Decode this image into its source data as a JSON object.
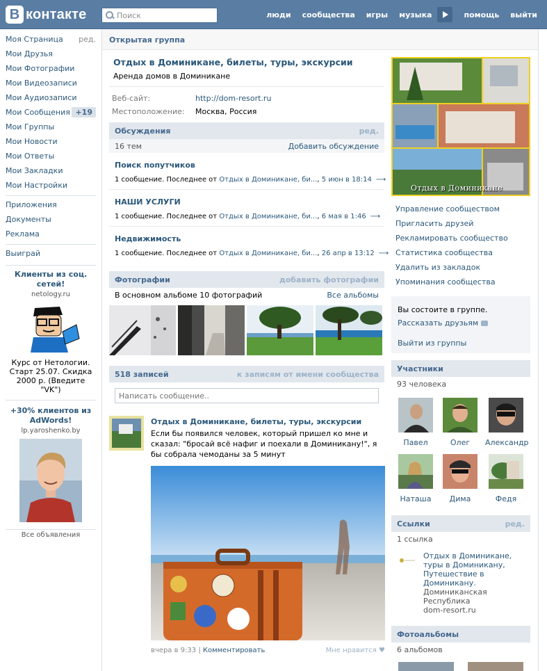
{
  "header": {
    "logo_letter": "В",
    "logo_text": "контакте",
    "search_placeholder": "Поиск",
    "nav": [
      "люди",
      "сообщества",
      "игры",
      "музыка",
      "помощь",
      "выйти"
    ]
  },
  "left_menu": {
    "items": [
      {
        "label": "Моя Страница",
        "extra": "ред."
      },
      {
        "label": "Мои Друзья"
      },
      {
        "label": "Мои Фотографии"
      },
      {
        "label": "Мои Видеозаписи"
      },
      {
        "label": "Мои Аудиозаписи"
      },
      {
        "label": "Мои Сообщения",
        "count": "+19"
      },
      {
        "label": "Мои Группы"
      },
      {
        "label": "Мои Новости"
      },
      {
        "label": "Мои Ответы"
      },
      {
        "label": "Мои Закладки"
      },
      {
        "label": "Мои Настройки"
      }
    ],
    "secondary": [
      "Приложения",
      "Документы",
      "Реклама"
    ],
    "tertiary": [
      "Выиграй"
    ]
  },
  "ads": [
    {
      "title": "Клиенты из соц. сетей!",
      "domain": "netology.ru",
      "text": "Курс от Нетологии. Старт 25.07. Скидка 2000 р. (Введите \"VK\")"
    },
    {
      "title": "+30% клиентов из AdWords!",
      "domain": "lp.yaroshenko.by"
    }
  ],
  "all_ads_label": "Все объявления",
  "breadcrumb": "Открытая группа",
  "group": {
    "name": "Отдых в Доминикане, билеты, туры, экскурсии",
    "status": "Аренда домов в Доминикане",
    "website_label": "Веб-сайт:",
    "website_value": "http://dom-resort.ru",
    "location_label": "Местоположение:",
    "location_value": "Москва, Россия",
    "cover_caption": "Отдых в Доминикане"
  },
  "discussions": {
    "title": "Обсуждения",
    "edit": "ред.",
    "count": "16 тем",
    "add": "Добавить обсуждение",
    "topics": [
      {
        "title": "Поиск попутчиков",
        "meta_prefix": "1 сообщение. Последнее от ",
        "author": "Отдых в Доминикане, би...",
        "date": "5 июн в 18:14"
      },
      {
        "title": "НАШИ УСЛУГИ",
        "meta_prefix": "1 сообщение. Последнее от ",
        "author": "Отдых в Доминикане, би...",
        "date": "6 мая в 1:46"
      },
      {
        "title": "Недвижимость",
        "meta_prefix": "1 сообщение. Последнее от ",
        "author": "Отдых в Доминикане, би...",
        "date": "26 апр в 13:12"
      }
    ]
  },
  "photos": {
    "title": "Фотографии",
    "add": "добавить фотографии",
    "info": "В основном альбоме 10 фотографий",
    "all": "Все альбомы"
  },
  "wall": {
    "title": "518 записей",
    "as_group": "к записям от имени сообщества",
    "input_placeholder": "Написать сообщение..",
    "post": {
      "author": "Отдых в Доминикане, билеты, туры, экскурсии",
      "text": "Если бы появился человек, который пришел ко мне и сказал: \"бросай всё нафиг и поехали в Доминикану!\", я бы собрала чемоданы за 5 минут",
      "time": "вчера в 9:33",
      "comment": "Комментировать",
      "like": "Мне нравится"
    }
  },
  "admin_links": [
    "Управление сообществом",
    "Пригласить друзей",
    "Рекламировать сообщество",
    "Статистика сообщества",
    "Удалить из закладок",
    "Упоминания сообщества"
  ],
  "membership": {
    "status": "Вы состоите в группе.",
    "tell": "Рассказать друзьям",
    "leave": "Выйти из группы"
  },
  "members": {
    "title": "Участники",
    "count": "93 человека",
    "list": [
      "Павел",
      "Олег",
      "Александр",
      "Наташа",
      "Дима",
      "Федя"
    ]
  },
  "links": {
    "title": "Ссылки",
    "edit": "ред.",
    "count": "1 ссылка",
    "item_title": "Отдых в Доминикане, туры в Доминикану, Путешествие в Доминикану.",
    "item_desc": "Доминиканская Республика",
    "item_url": "dom-resort.ru"
  },
  "albums": {
    "title": "Фотоальбомы",
    "count": "6 альбомов"
  },
  "colors": {
    "header": "#597da3",
    "link": "#2b587a",
    "section_bar": "#e1e7ed"
  }
}
